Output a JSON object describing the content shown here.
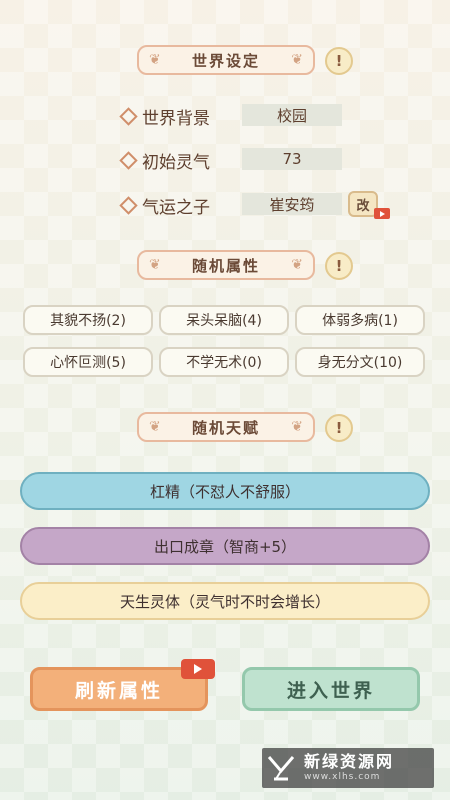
{
  "sections": {
    "world": {
      "title": "世界设定",
      "info": "!"
    },
    "attributes": {
      "title": "随机属性",
      "info": "!"
    },
    "talents": {
      "title": "随机天赋",
      "info": "!"
    }
  },
  "world_settings": [
    {
      "label": "世界背景",
      "value": "校园"
    },
    {
      "label": "初始灵气",
      "value": "73"
    },
    {
      "label": "气运之子",
      "value": "崔安筠"
    }
  ],
  "change_button": {
    "label": "改"
  },
  "attributes": [
    "其貌不扬(2)",
    "呆头呆脑(4)",
    "体弱多病(1)",
    "心怀叵测(5)",
    "不学无术(0)",
    "身无分文(10)"
  ],
  "talents": [
    {
      "label": "杠精（不怼人不舒服）",
      "color": "#9fd6e3"
    },
    {
      "label": "出口成章（智商+5）",
      "color": "#c5a7c8"
    },
    {
      "label": "天生灵体（灵气时不时会增长）",
      "color": "#fbeec8"
    }
  ],
  "buttons": {
    "refresh": "刷新属性",
    "enter": "进入世界"
  },
  "watermark": {
    "cn": "新绿资源网",
    "en": "www.xlhs.com"
  }
}
